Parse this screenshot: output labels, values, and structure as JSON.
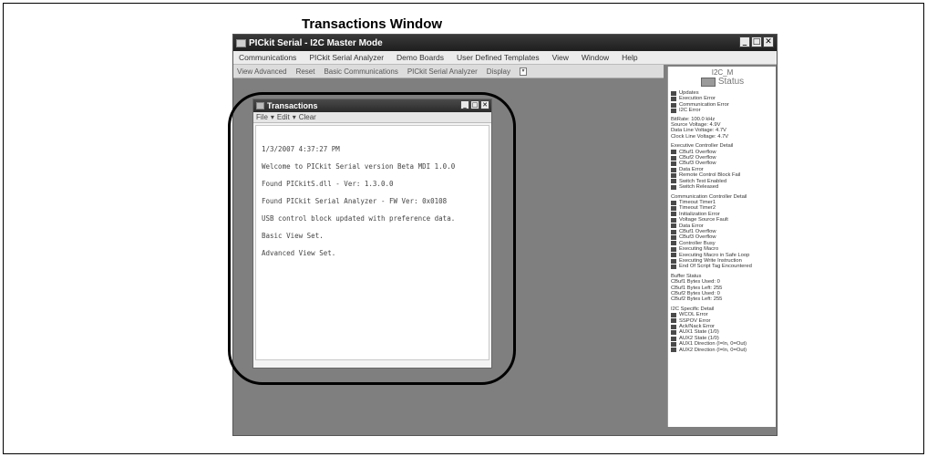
{
  "callout": {
    "title": "Transactions Window"
  },
  "app": {
    "title": "PICkit Serial - I2C Master Mode",
    "menu": [
      "Communications",
      "PICkit Serial Analyzer",
      "Demo Boards",
      "User Defined Templates",
      "View",
      "Window",
      "Help"
    ],
    "toolbar": [
      "View Advanced",
      "Reset",
      "Basic Communications",
      "PICkit Serial Analyzer",
      "Display"
    ]
  },
  "transactions": {
    "title": "Transactions",
    "menu": [
      "File",
      "Edit",
      "Clear"
    ],
    "lines": [
      "1/3/2007 4:37:27 PM",
      "Welcome to PICkit Serial version Beta MDI 1.0.0",
      "Found PICkitS.dll - Ver: 1.3.0.0",
      "Found PICkit Serial Analyzer - FW Ver: 0x0108",
      "USB control block updated with preference data.",
      "Basic View Set.",
      "Advanced View Set."
    ]
  },
  "status": {
    "mode": "I2C_M",
    "label": "Status",
    "top": [
      "Updates",
      "Execution Error",
      "Communication Error",
      "I2C Error"
    ],
    "info": [
      "BitRate: 100.0 kHz",
      "Source Voltage: 4.9V",
      "Data Line Voltage: 4.7V",
      "Clock Line Voltage: 4.7V"
    ],
    "exec_title": "Executive Controller Detail",
    "exec": [
      "CBuf1 Overflow",
      "CBuf2 Overflow",
      "CBuf3 Overflow",
      "Data Error",
      "Remote Control Block Fail",
      "Switch Test Enabled",
      "Switch Released"
    ],
    "comm_title": "Communication Controller Detail",
    "comm": [
      "Timeout Timer1",
      "Timeout Timer2",
      "Initialization Error",
      "Voltage Source Fault",
      "Data Error",
      "CBuf1 Overflow",
      "CBuf3 Overflow",
      "Controller Busy",
      "Executing Macro",
      "Executing Macro in Safe Loop",
      "Executing Write Instruction",
      "End Of Script Tag Encountered"
    ],
    "buffer_title": "Buffer Status",
    "buffer": [
      "CBuf1 Bytes Used: 0",
      "CBuf1 Bytes Left: 255",
      "CBuf2 Bytes Used: 0",
      "CBuf2 Bytes Left: 255"
    ],
    "i2c_title": "I2C Specific Detail",
    "i2c": [
      "WCOL Error",
      "SSPOV Error",
      "Ack/Nack Error",
      "AUX1 State (1/0)",
      "AUX2 State (1/0)",
      "AUX1 Direction (I=In, 0=Out)",
      "AUX2 Direction (I=In, 0=Out)"
    ]
  }
}
